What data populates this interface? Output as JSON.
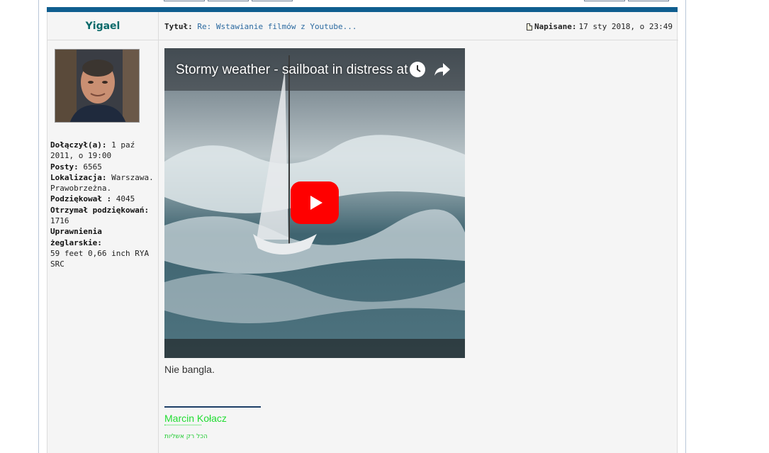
{
  "author": {
    "name": "Yigael",
    "profile": {
      "joined_label": "Dołączył(a):",
      "joined_value": "1 paź 2011, o 19:00",
      "posts_label": "Posty:",
      "posts_value": "6565",
      "location_label": "Lokalizacja:",
      "location_value": "Warszawa. Prawobrzeżna.",
      "thanked_label": "Podziękował :",
      "thanked_value": "4045",
      "received_label": "Otrzymał podziękowań:",
      "received_value": "1716",
      "license_label": "Uprawnienia żeglarskie:",
      "license_value": "59 feet 0,66 inch RYA SRC"
    }
  },
  "post": {
    "subject_label": "Tytuł:",
    "subject_value": "Re: Wstawianie filmów z Youtube...",
    "posted_label": "Napisane:",
    "posted_value": "17 sty 2018, o 23:49",
    "video_title": "Stormy weather - sailboat in distress at ...",
    "body": "Nie bangla.",
    "signature_name": "Marcin Kołacz",
    "signature_sub": "הכל רק אשליות"
  },
  "colors": {
    "topbar": "#0f5e8f",
    "author_name": "#0a6a6a",
    "link": "#2c6aa0",
    "signature": "#22dd33",
    "play_button": "#ff0000"
  },
  "icons": [
    "doc-icon",
    "clock-icon",
    "share-icon",
    "play-icon"
  ]
}
